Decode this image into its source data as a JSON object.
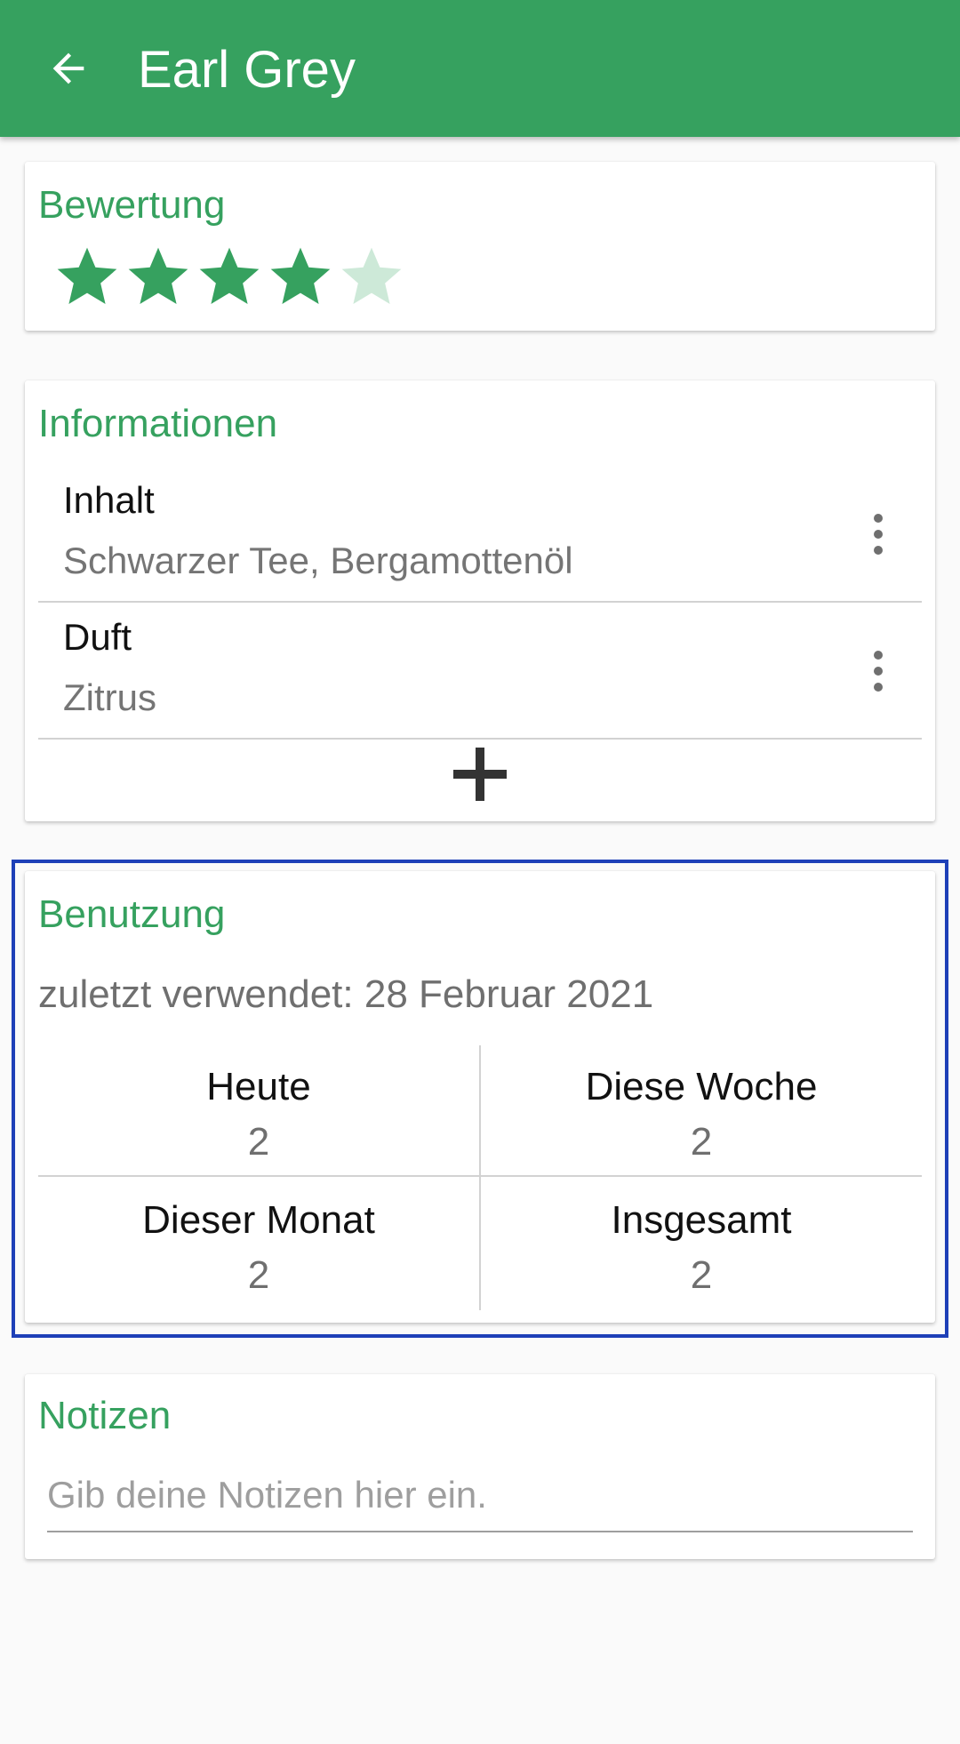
{
  "appbar": {
    "title": "Earl Grey",
    "back_icon": "arrow-back-icon",
    "color": "#36a15f"
  },
  "rating": {
    "title": "Bewertung",
    "value": 4,
    "max": 5,
    "star_color": "#36a15f",
    "star_empty_color": "#cde9d8"
  },
  "info": {
    "title": "Informationen",
    "items": [
      {
        "label": "Inhalt",
        "value": "Schwarzer Tee, Bergamottenöl"
      },
      {
        "label": "Duft",
        "value": "Zitrus"
      }
    ],
    "add_icon": "plus-icon",
    "more_icon": "more-vert-icon"
  },
  "usage": {
    "title": "Benutzung",
    "last_used": "zuletzt verwendet: 28 Februar 2021",
    "stats": [
      {
        "label": "Heute",
        "value": "2"
      },
      {
        "label": "Diese Woche",
        "value": "2"
      },
      {
        "label": "Dieser Monat",
        "value": "2"
      },
      {
        "label": "Insgesamt",
        "value": "2"
      }
    ],
    "highlight_color": "#1e40b8"
  },
  "notes": {
    "title": "Notizen",
    "placeholder": "Gib deine Notizen hier ein.",
    "value": ""
  }
}
